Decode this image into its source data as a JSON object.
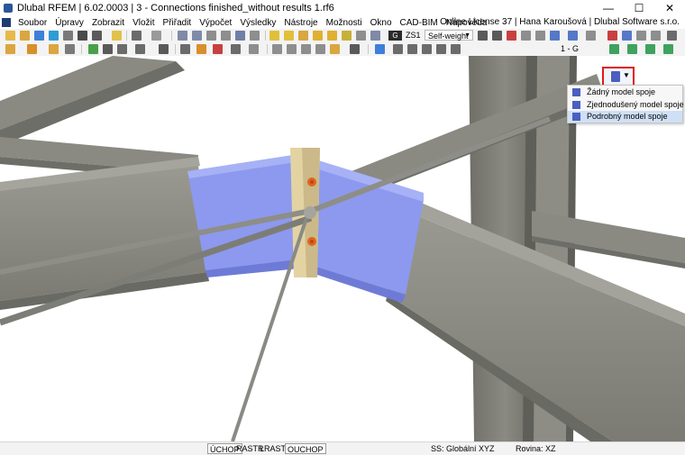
{
  "window": {
    "title": "Dlubal RFEM | 6.02.0003 | 3 - Connections finished_without results 1.rf6",
    "minimize_glyph": "—",
    "maximize_glyph": "☐",
    "close_glyph": "✕"
  },
  "menu": {
    "items": [
      "Soubor",
      "Úpravy",
      "Zobrazit",
      "Vložit",
      "Přiřadit",
      "Výpočet",
      "Výsledky",
      "Nástroje",
      "Možnosti",
      "Okno",
      "CAD-BIM",
      "Nápověda"
    ],
    "license_info": "Online License 37 | Hana Karoušová | Dlubal Software s.r.o."
  },
  "toolbar": {
    "load_case_color_label": "G",
    "load_case_id": "ZS1",
    "load_case_name": "Self-weight",
    "tab_label": "1 - G"
  },
  "connection_model": {
    "options": [
      "Žádný model spoje",
      "Zjednodušený model spoje",
      "Podrobný model spoje"
    ],
    "selected_index": 2
  },
  "statusbar": {
    "toggles": [
      "ÚCHOP",
      "RASTR",
      "LRASTR",
      "OUCHOP"
    ],
    "coordinate_system": "SS: Globální XYZ",
    "plane": "Rovina: XZ"
  },
  "colors": {
    "steel": "#8c8c84",
    "steel_dark": "#6d6d66",
    "plate_blue": "#8c99ee",
    "end_plate": "#e3d3a3",
    "bolt": "#e0641e",
    "highlight_border": "#e01a1a"
  }
}
